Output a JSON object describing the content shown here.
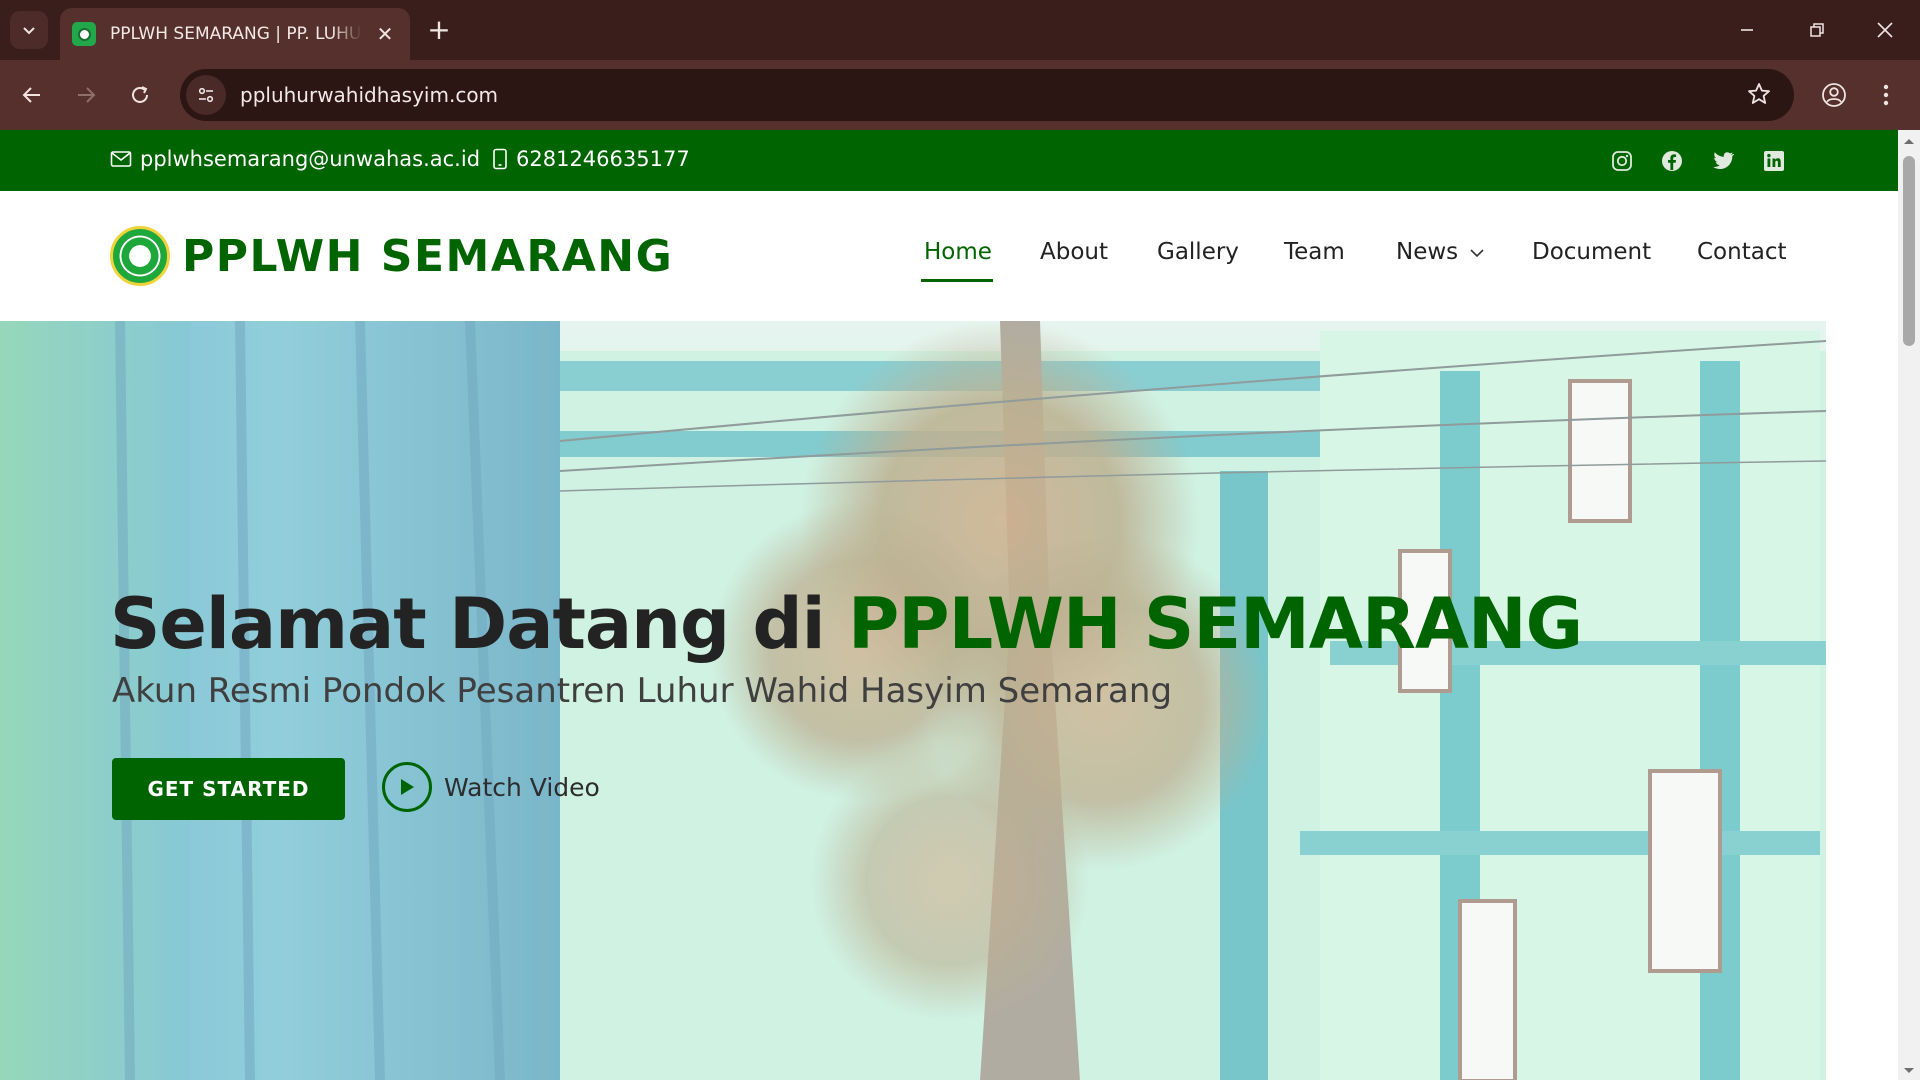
{
  "browser": {
    "tab_title": "PPLWH SEMARANG | PP. LUHUR WAHID HASYIM",
    "url": "ppluhurwahidhasyim.com",
    "icons": [
      "tab-search-icon",
      "favicon-icon",
      "close-icon",
      "new-tab-icon",
      "minimize-icon",
      "restore-icon",
      "window-close-icon",
      "back-icon",
      "forward-icon",
      "reload-icon",
      "site-info-icon",
      "bookmark-star-icon",
      "profile-icon",
      "menu-icon"
    ]
  },
  "topbar": {
    "email": "pplwhsemarang@unwahas.ac.id",
    "phone": "6281246635177",
    "social": [
      "instagram-icon",
      "facebook-icon",
      "twitter-icon",
      "linkedin-icon"
    ],
    "color": "#006400"
  },
  "header": {
    "logo_text": "PPLWH SEMARANG",
    "nav": {
      "home": "Home",
      "about": "About",
      "gallery": "Gallery",
      "team": "Team",
      "news": "News",
      "document": "Document",
      "contact": "Contact"
    },
    "active": "Home"
  },
  "hero": {
    "title_prefix": "Selamat Datang di",
    "title_accent": "PPLWH SEMARANG",
    "subtitle": "Akun Resmi Pondok Pesantren Luhur Wahid Hasyim Semarang",
    "cta_label": "GET STARTED",
    "video_label": "Watch Video",
    "accent_color": "#006400"
  }
}
